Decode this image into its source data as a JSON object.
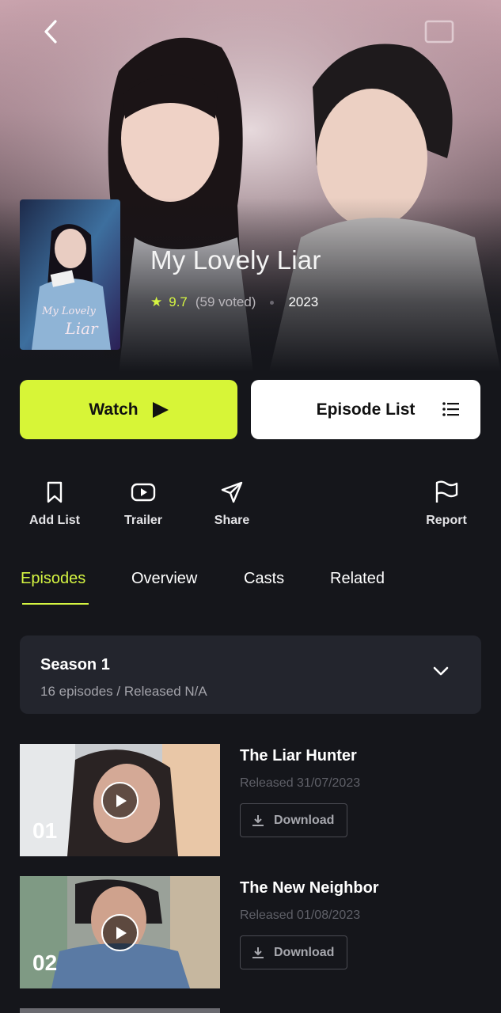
{
  "header": {
    "back_icon": "chevron-left-icon",
    "cast_icon": "cast-icon"
  },
  "show": {
    "title": "My Lovely Liar",
    "rating": "9.7",
    "votes": "(59 voted)",
    "year": "2023",
    "poster_text": "My Lovely Liar"
  },
  "buttons": {
    "watch": "Watch",
    "episode_list": "Episode List"
  },
  "actions": [
    {
      "label": "Add List",
      "icon": "bookmark-icon"
    },
    {
      "label": "Trailer",
      "icon": "youtube-icon"
    },
    {
      "label": "Share",
      "icon": "send-icon"
    },
    {
      "label": "Report",
      "icon": "flag-icon"
    }
  ],
  "tabs": [
    {
      "label": "Episodes",
      "active": true
    },
    {
      "label": "Overview",
      "active": false
    },
    {
      "label": "Casts",
      "active": false
    },
    {
      "label": "Related",
      "active": false
    }
  ],
  "season": {
    "name": "Season 1",
    "subtitle": "16 episodes / Released N/A"
  },
  "episodes": [
    {
      "number": "01",
      "title": "The Liar Hunter",
      "released": "Released 31/07/2023",
      "download": "Download"
    },
    {
      "number": "02",
      "title": "The New Neighbor",
      "released": "Released 01/08/2023",
      "download": "Download"
    }
  ],
  "colors": {
    "accent": "#d7f537",
    "background": "#15161b",
    "card": "#23252d"
  }
}
